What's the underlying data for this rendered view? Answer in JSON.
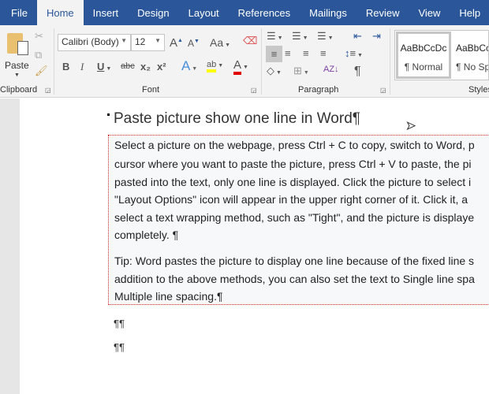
{
  "tabs": [
    "File",
    "Home",
    "Insert",
    "Design",
    "Layout",
    "References",
    "Mailings",
    "Review",
    "View",
    "Help"
  ],
  "ribbon": {
    "clipboard": {
      "paste": "Paste",
      "label": "Clipboard"
    },
    "font": {
      "name": "Calibri (Body)",
      "size": "12",
      "label": "Font",
      "change_case": "Aa",
      "bold": "B",
      "italic": "I",
      "underline": "U",
      "strike": "abc",
      "subscript": "x₂",
      "superscript": "x²",
      "effects": "A",
      "highlight": "ab",
      "font_color": "A"
    },
    "paragraph": {
      "label": "Paragraph",
      "show_marks": "¶"
    },
    "styles": {
      "label": "Styles",
      "items": [
        {
          "preview": "AaBbCcDc",
          "name": "¶ Normal"
        },
        {
          "preview": "AaBbCc",
          "name": "¶ No Spac"
        }
      ]
    }
  },
  "document": {
    "title": "Paste picture show one line in Word¶",
    "para1": [
      "Select a picture on the webpage, press Ctrl + C to copy, switch to Word, p",
      "cursor where you want to paste the picture, press Ctrl + V to paste, the pi",
      "pasted into the text, only one line is displayed. Click the picture to select i",
      "\"Layout Options\" icon will appear in the upper right corner of it. Click it, a",
      "select a text wrapping method, such as \"Tight\", and the picture is displaye",
      "completely. ¶"
    ],
    "para2": [
      "Tip: Word pastes the picture to display one line because of the fixed line s",
      "addition to the above methods, you can also set the text to Single line spa",
      "Multiple line spacing.¶"
    ],
    "empty_marks": [
      "¶¶",
      "¶¶"
    ]
  }
}
